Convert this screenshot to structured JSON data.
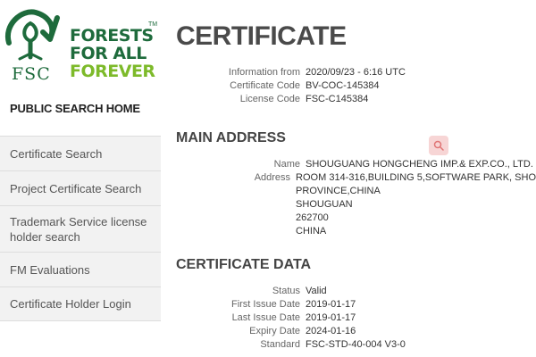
{
  "brand": {
    "fsc": "FSC",
    "slogan_line1": "FORESTS",
    "slogan_line2": "FOR ALL",
    "slogan_line3": "FOREVER",
    "tm": "TM"
  },
  "sidebar": {
    "heading": "PUBLIC SEARCH HOME",
    "items": [
      {
        "label": "Certificate Search"
      },
      {
        "label": "Project Certificate Search"
      },
      {
        "label": "Trademark Service license holder search"
      },
      {
        "label": "FM Evaluations"
      },
      {
        "label": "Certificate Holder Login"
      }
    ]
  },
  "certificate": {
    "title": "CERTIFICATE",
    "info_from_label": "Information from",
    "info_from_value": "2020/09/23 - 6:16 UTC",
    "code_label": "Certificate Code",
    "code_value": "BV-COC-145384",
    "license_label": "License Code",
    "license_value": "FSC-C145384"
  },
  "main_address": {
    "title": "MAIN ADDRESS",
    "name_label": "Name",
    "name_value": "SHOUGUANG HONGCHENG IMP.& EXP.CO., LTD.",
    "address_label": "Address",
    "address_lines": [
      "ROOM 314-316,BUILDING 5,SOFTWARE PARK, SHO",
      "PROVINCE,CHINA",
      "SHOUGUAN",
      "262700",
      "CHINA"
    ]
  },
  "certificate_data": {
    "title": "CERTIFICATE DATA",
    "status_label": "Status",
    "status_value": "Valid",
    "first_issue_label": "First Issue Date",
    "first_issue_value": "2019-01-17",
    "last_issue_label": "Last Issue Date",
    "last_issue_value": "2019-01-17",
    "expiry_label": "Expiry Date",
    "expiry_value": "2024-01-16",
    "standard_label": "Standard",
    "standard_value": "FSC-STD-40-004 V3-0"
  },
  "icons": {
    "search": "search-icon"
  }
}
